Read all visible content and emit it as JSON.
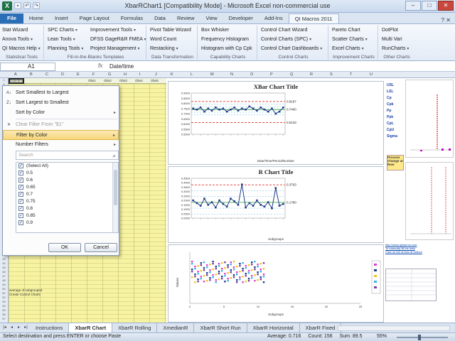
{
  "window": {
    "title": "XbarRChart1  [Compatibility Mode]  -  Microsoft Excel non-commercial use",
    "logo": "X"
  },
  "ribbon_tabs": [
    "File",
    "Home",
    "Insert",
    "Page Layout",
    "Formulas",
    "Data",
    "Review",
    "View",
    "Developer",
    "Add-Ins",
    "QI Macros 2011"
  ],
  "ribbon_groups": [
    {
      "label": "Statistical Tools",
      "rows": [
        "Stat Wizard",
        "Anova Tools",
        "QI Macros Help"
      ]
    },
    {
      "label": "Fill-in-the-Blanks Templates",
      "rows": [
        "SPC Charts",
        "Lean Tools",
        "Planning Tools",
        "Improvement Tools",
        "DFSS GageR&R FMEA",
        "Project Management"
      ]
    },
    {
      "label": "Data Transformation",
      "rows": [
        "Pivot Table Wizard",
        "Word Count",
        "Restacking"
      ]
    },
    {
      "label": "Capability Charts",
      "rows": [
        "Box Whisker",
        "Frequency Histogram",
        "Histogram with Cp Cpk"
      ]
    },
    {
      "label": "Control Charts",
      "rows": [
        "Control Chart Wizard",
        "Control Charts (SPC)",
        "Control Chart Dashboards"
      ]
    },
    {
      "label": "Improvement Charts",
      "rows": [
        "Pareto Chart",
        "Scatter Charts",
        "Excel Charts"
      ]
    },
    {
      "label": "Other Charts",
      "rows": [
        "DotPlot",
        "Multi Vari",
        "RunCharts"
      ]
    }
  ],
  "formula_bar": {
    "name_box": "A1",
    "fx": "fx",
    "value": "Date/time"
  },
  "filter_menu": {
    "items": [
      {
        "label": "Sort Smallest to Largest",
        "icon": "A↓",
        "state": "normal"
      },
      {
        "label": "Sort Largest to Smallest",
        "icon": "Z↓",
        "state": "normal"
      },
      {
        "label": "Sort by Color",
        "icon": "",
        "state": "submenu"
      },
      {
        "label": "Clear Filter From \"$1\"",
        "icon": "✕",
        "state": "disabled"
      },
      {
        "label": "Filter by Color",
        "icon": "",
        "state": "highlighted"
      },
      {
        "label": "Number Filters",
        "icon": "",
        "state": "submenu"
      }
    ],
    "search_placeholder": "Search",
    "values": [
      "(Select All)",
      "0.5",
      "0.6",
      "0.65",
      "0.7",
      "0.75",
      "0.8",
      "0.85",
      "0.9"
    ],
    "ok_label": "OK",
    "cancel_label": "Cancel"
  },
  "charts": {
    "xbar": {
      "title": "XBar Chart Title",
      "ucl": "0.8187",
      "cl": "0.7400",
      "lcl": "0.6133",
      "xlabel": "Date/Time/Period/Number",
      "y_ticks": [
        "0.9000",
        "0.8500",
        "0.8000",
        "0.7500",
        "0.7000",
        "0.6500",
        "0.6000",
        "0.5500",
        "0.5000"
      ]
    },
    "r": {
      "title": "R Chart Title",
      "ucl": "0.3763",
      "cl": "0.1780",
      "xlabel": "Subgroups",
      "y_ticks": [
        "0.4500",
        "0.4000",
        "0.3500",
        "0.3000",
        "0.2500",
        "0.2000",
        "0.1500",
        "0.1000",
        "0.0500",
        "0.0000"
      ]
    },
    "scatter": {
      "xlabel": "Subgroups",
      "ylabel": "Values",
      "x_ticks": [
        "0",
        "5",
        "10",
        "15",
        "20",
        "25"
      ]
    }
  },
  "chart_data": [
    {
      "type": "line",
      "title": "XBar Chart Title",
      "xlabel": "Date/Time/Period/Number",
      "ylim": [
        0.5,
        0.9
      ],
      "control_limits": {
        "UCL": 0.8187,
        "CL": 0.74,
        "LCL": 0.6133
      },
      "series": [
        {
          "values": [
            0.75,
            0.74,
            0.76,
            0.72,
            0.75,
            0.73,
            0.76,
            0.74,
            0.75,
            0.72,
            0.74,
            0.76,
            0.73,
            0.75,
            0.74,
            0.77,
            0.75,
            0.73,
            0.76,
            0.74,
            0.72,
            0.75,
            0.7,
            0.72,
            0.76
          ]
        }
      ]
    },
    {
      "type": "line",
      "title": "R Chart Title",
      "xlabel": "Subgroups",
      "ylim": [
        0,
        0.45
      ],
      "control_limits": {
        "UCL": 0.3763,
        "CL": 0.178
      },
      "series": [
        {
          "values": [
            0.2,
            0.17,
            0.14,
            0.22,
            0.15,
            0.18,
            0.12,
            0.2,
            0.16,
            0.13,
            0.22,
            0.19,
            0.15,
            0.38,
            0.12,
            0.17,
            0.14,
            0.2,
            0.15,
            0.13,
            0.18,
            0.11,
            0.34,
            0.14,
            0.16
          ]
        }
      ]
    }
  ],
  "right_stats": {
    "labels": [
      "USL",
      "LSL",
      "Cp",
      "Cpk",
      "Pp",
      "Ppk",
      "CpL",
      "CpU",
      "Sigma"
    ],
    "values": [
      "0.9",
      "0.5",
      "0.86",
      "0.72",
      "0.84",
      "0.70",
      "0.95",
      "0.74",
      "0.035"
    ],
    "process_note": "Process Change at Row"
  },
  "sheet_tabs": [
    "Instructions",
    "XbarR Chart",
    "XbarR Rolling",
    "XmedianR",
    "XbarR Short Run",
    "XbarR Horizontal",
    "XbarR Fixed"
  ],
  "active_sheet": "XbarR Chart",
  "status": {
    "message": "Select destination and press ENTER or choose Paste",
    "average": "Average: 0.716",
    "count": "Count: 156",
    "sum": "Sum: 89.5",
    "zoom": "55%"
  },
  "grid_notes": [
    "average of subgrouped",
    "Create Control Charts"
  ],
  "column_headers": [
    "A",
    "B",
    "C",
    "D",
    "E",
    "F",
    "G",
    "H",
    "I",
    "J",
    "K",
    "L",
    "M",
    "N",
    "O",
    "P",
    "Q",
    "R",
    "S",
    "T",
    "U"
  ],
  "colors": {
    "accent": "#2a6fb6",
    "highlight": "#f7d77b",
    "yellow_cells": "#f7f3a0",
    "chart_line": "#1f3c88",
    "limit_line": "#d9302c"
  }
}
